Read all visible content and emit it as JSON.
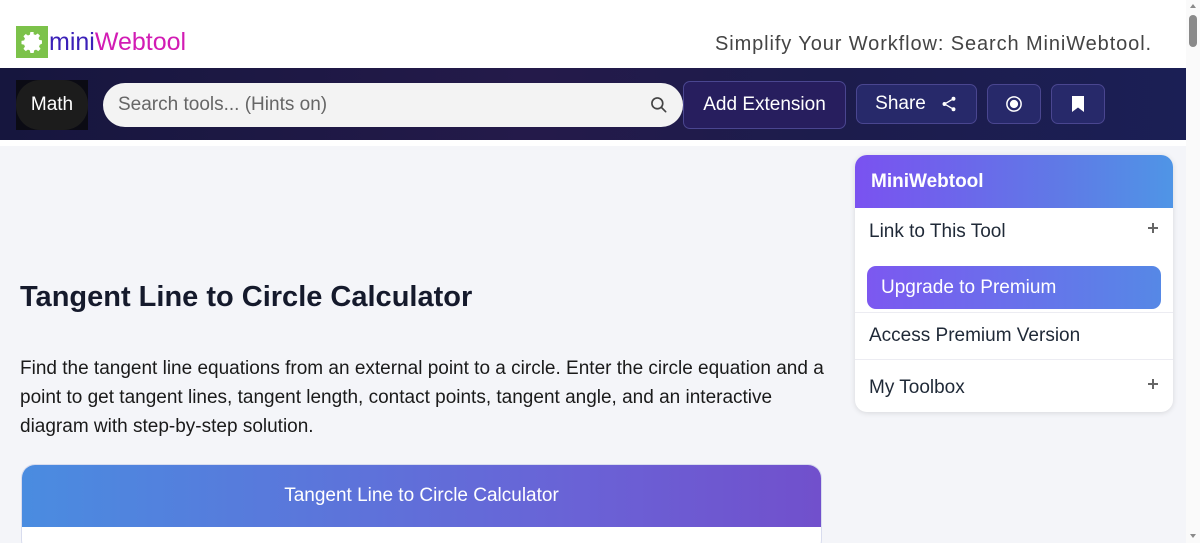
{
  "header": {
    "logo_part1": "mini",
    "logo_part2": "Webtool",
    "logo_icon": "gear-icon",
    "tagline": "Simplify Your Workflow: Search MiniWebtool."
  },
  "navbar": {
    "category_label": "Math",
    "search_placeholder": "Search tools... (Hints on)",
    "search_value": "",
    "add_extension_label": "Add Extension",
    "share_label": "Share",
    "icons": [
      "search-icon",
      "share-icon",
      "record-icon",
      "bookmark-icon"
    ]
  },
  "main": {
    "title": "Tangent Line to Circle Calculator",
    "description": "Find the tangent line equations from an external point to a circle. Enter the circle equation and a point to get tangent lines, tangent length, contact points, tangent angle, and an interactive diagram with step-by-step solution.",
    "card_title": "Tangent Line to Circle Calculator"
  },
  "sidebar": {
    "title": "MiniWebtool",
    "link_label": "Link to This Tool",
    "premium_label": "Upgrade to Premium",
    "access_label": "Access Premium Version",
    "toolbox_label": "My Toolbox"
  },
  "colors": {
    "logo_mini": "#3b20b8",
    "logo_webtool": "#d21cb4",
    "logo_icon_bg": "#7cc24a",
    "navbar_bg": "#1b1a48",
    "accent_gradient_start": "#7a52f0",
    "accent_gradient_end": "#4f95e6"
  }
}
